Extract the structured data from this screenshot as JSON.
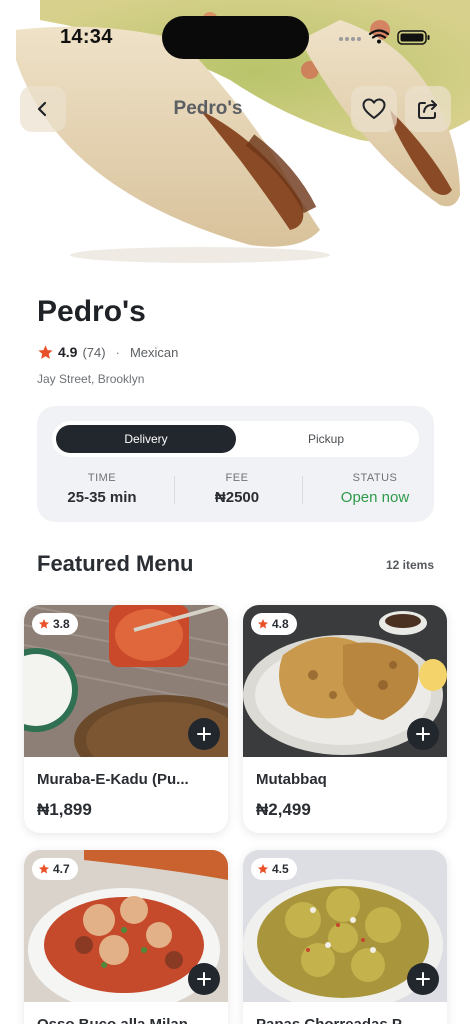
{
  "status_bar": {
    "time": "14:34"
  },
  "nav": {
    "title": "Pedro's",
    "back_icon": "chevron-left-icon",
    "favorite_icon": "heart-icon",
    "share_icon": "share-icon"
  },
  "restaurant": {
    "name": "Pedro's",
    "rating": "4.9",
    "review_count": "(74)",
    "separator": "·",
    "cuisine": "Mexican",
    "address": "Jay Street, Brooklyn"
  },
  "order_mode": {
    "options": [
      "Delivery",
      "Pickup"
    ],
    "selected": "Delivery"
  },
  "stats": {
    "time_label": "TIME",
    "time_value": "25-35 min",
    "fee_label": "FEE",
    "fee_value": "₦2500",
    "status_label": "STATUS",
    "status_value": "Open now"
  },
  "featured": {
    "title": "Featured Menu",
    "count": "12 items",
    "items": [
      {
        "name": "Muraba-E-Kadu (Pu...",
        "price": "₦1,899",
        "rating": "3.8"
      },
      {
        "name": "Mutabbaq",
        "price": "₦2,499",
        "rating": "4.8"
      },
      {
        "name": "Osso Buco alla Milan...",
        "price": "",
        "rating": "4.7"
      },
      {
        "name": "Papas Chorreadas P...",
        "price": "",
        "rating": "4.5"
      }
    ]
  },
  "colors": {
    "accent_dark": "#22262d",
    "open_green": "#2e9b4b",
    "star_orange": "#e8512a",
    "card_bg": "#f1f2f5"
  }
}
